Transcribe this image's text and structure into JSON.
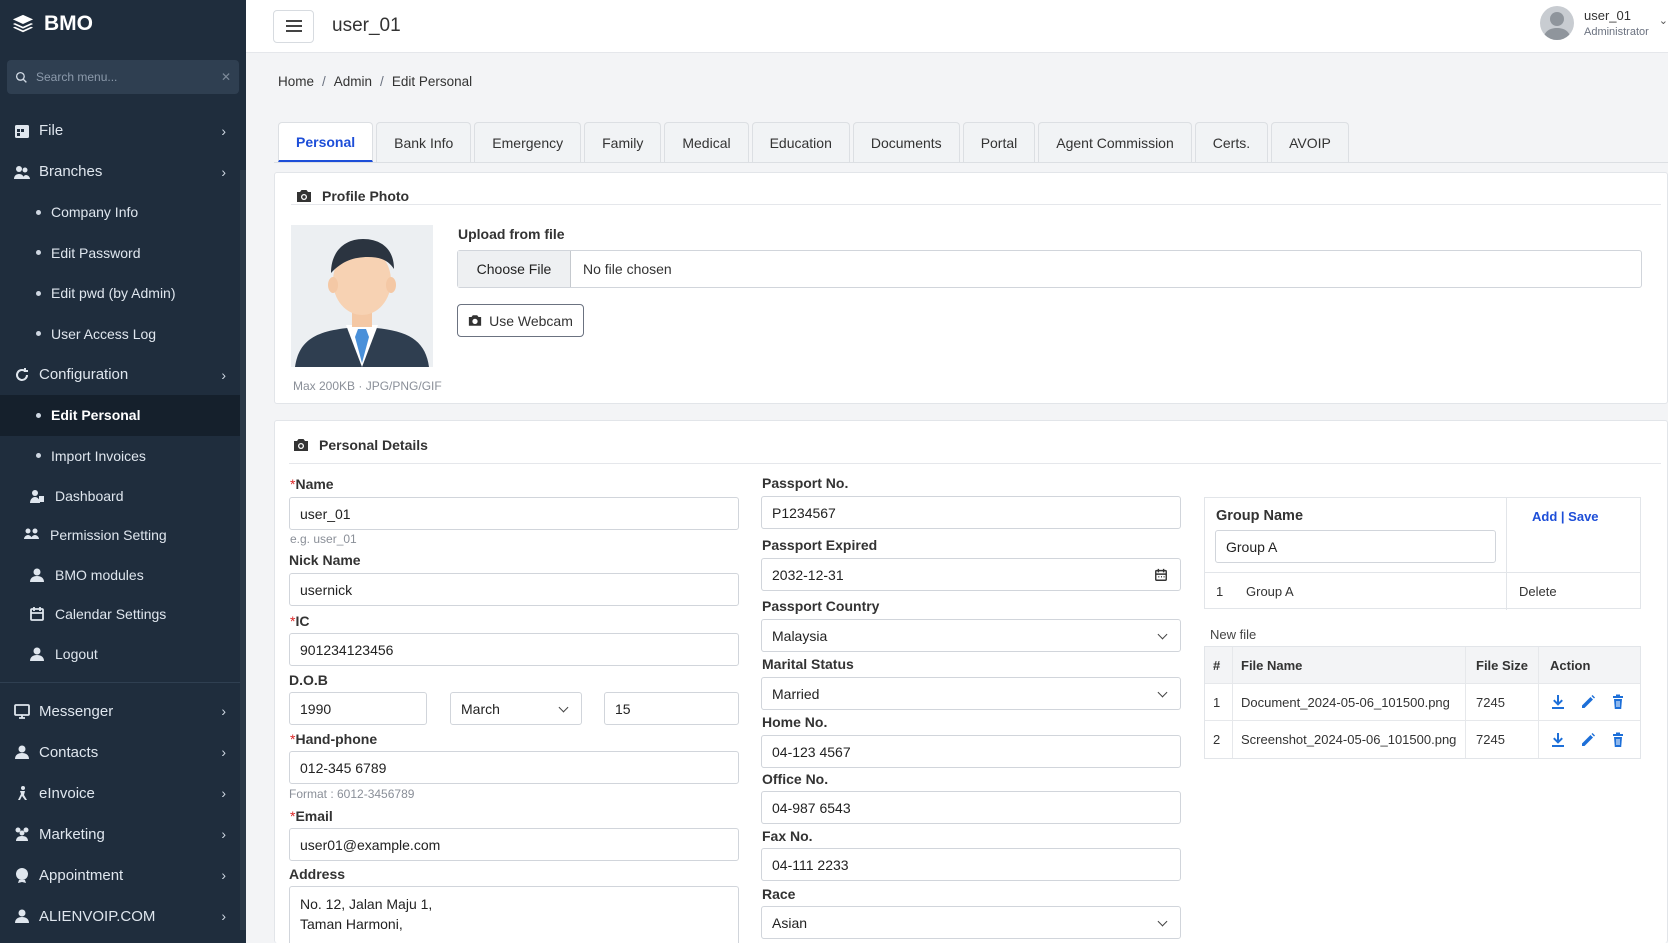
{
  "brand": {
    "name": "BMO"
  },
  "search": {
    "placeholder": "Search menu..."
  },
  "sidebar": {
    "items": [
      {
        "label": "File"
      },
      {
        "label": "Branches"
      },
      {
        "label": "Company Info"
      },
      {
        "label": "Edit Password"
      },
      {
        "label": "Edit pwd (by Admin)"
      },
      {
        "label": "User Access Log"
      },
      {
        "label": "Configuration"
      },
      {
        "label": "Edit Personal"
      },
      {
        "label": "Import Invoices"
      },
      {
        "label": "Dashboard"
      },
      {
        "label": "Permission Setting"
      },
      {
        "label": "BMO modules"
      },
      {
        "label": "Calendar Settings"
      },
      {
        "label": "Logout"
      },
      {
        "label": "Messenger"
      },
      {
        "label": "Contacts"
      },
      {
        "label": "eInvoice"
      },
      {
        "label": "Marketing"
      },
      {
        "label": "Appointment"
      },
      {
        "label": "ALIENVOIP.COM"
      }
    ]
  },
  "topbar": {
    "title": "user_01",
    "user": "user_01",
    "role": "Administrator"
  },
  "breadcrumb": [
    "Home",
    "Admin",
    "Edit Personal"
  ],
  "tabs": [
    "Personal",
    "Bank Info",
    "Emergency",
    "Family",
    "Medical",
    "Education",
    "Documents",
    "Portal",
    "Agent Commission",
    "Certs.",
    "AVOIP"
  ],
  "profile": {
    "title": "Profile Photo",
    "upload_label": "Upload from file",
    "choose_file": "Choose File",
    "no_file": "No file chosen",
    "webcam": "Use Webcam",
    "hint": "Max 200KB · JPG/PNG/GIF"
  },
  "details": {
    "title": "Personal Details",
    "name_label": "Name",
    "name_value": "user_01",
    "name_hint": "e.g. user_01",
    "nick_label": "Nick Name",
    "nick_value": "usernick",
    "ic_label": "IC",
    "ic_value": "901234123456",
    "dob_label": "D.O.B",
    "dob_year": "1990",
    "dob_month": "March",
    "dob_day": "15",
    "hp_label": "Hand-phone",
    "hp_value": "012-345 6789",
    "hp_hint": "Format : 6012-3456789",
    "email_label": "Email",
    "email_value": "user01@example.com",
    "address_label": "Address",
    "address_line1": "No. 12, Jalan Maju 1,",
    "address_line2": "Taman Harmoni,",
    "passport_label": "Passport No.",
    "passport_value": "P1234567",
    "pexp_label": "Passport Expired",
    "pexp_value": "2032-12-31",
    "pcountry_label": "Passport Country",
    "pcountry_value": "Malaysia",
    "marital_label": "Marital Status",
    "marital_value": "Married",
    "home_label": "Home No.",
    "home_value": "04-123 4567",
    "office_label": "Office No.",
    "office_value": "04-987 6543",
    "fax_label": "Fax No.",
    "fax_value": "04-111 2233",
    "race_label": "Race",
    "race_value": "Asian"
  },
  "group": {
    "header": "Group Name",
    "add": "Add",
    "save": "Save",
    "sep": "|",
    "input_value": "Group A",
    "rows": [
      {
        "no": "1",
        "name": "Group A",
        "action": "Delete"
      }
    ]
  },
  "files": {
    "new_file": "New file",
    "headers": [
      "#",
      "File Name",
      "File Size",
      "Action"
    ],
    "rows": [
      {
        "no": "1",
        "name": "Document_2024-05-06_101500.png",
        "size": "7245"
      },
      {
        "no": "2",
        "name": "Screenshot_2024-05-06_101500.png",
        "size": "7245"
      }
    ]
  },
  "colors": {
    "sidebar": "#1f2d3d",
    "accent": "#1d4ed8",
    "required": "#dc2626"
  }
}
